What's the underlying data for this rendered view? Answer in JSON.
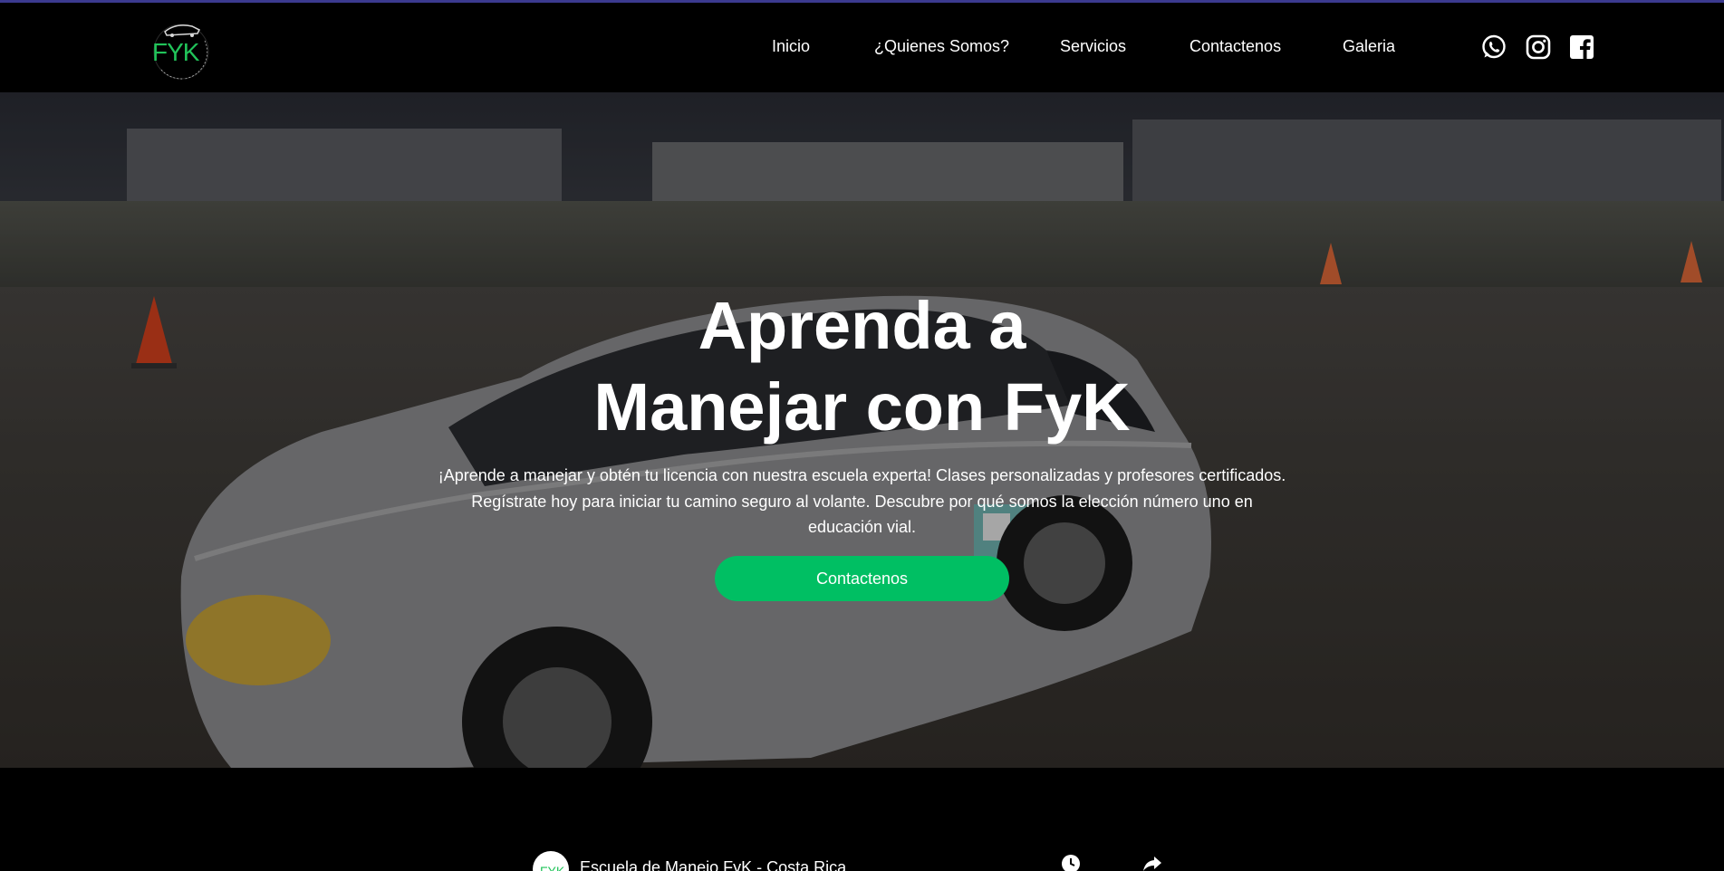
{
  "brand": {
    "logo_text": "FYK",
    "logo_subtext": "ESCUELA DE MANEJO",
    "accent_color": "#00bf63"
  },
  "nav": {
    "items": [
      {
        "label": "Inicio"
      },
      {
        "label": "¿Quienes Somos?"
      },
      {
        "label": "Servicios"
      },
      {
        "label": "Contactenos"
      },
      {
        "label": "Galeria"
      }
    ]
  },
  "social": {
    "icons": [
      "whatsapp-icon",
      "instagram-icon",
      "facebook-icon"
    ]
  },
  "hero": {
    "title_line1": "Aprenda a",
    "title_line2": "Manejar con FyK",
    "description": "¡Aprende a manejar y obtén tu licencia con nuestra escuela experta! Clases personalizadas y profesores certificados. Regístrate hoy para iniciar tu camino seguro al volante. Descubre por qué somos la elección número uno en educación vial.",
    "cta_label": "Contactenos"
  },
  "video": {
    "avatar_text": "FYK",
    "channel_name": "Escuela de Manejo FyK - Costa Rica",
    "icons": [
      "watch-later-icon",
      "share-icon"
    ]
  }
}
